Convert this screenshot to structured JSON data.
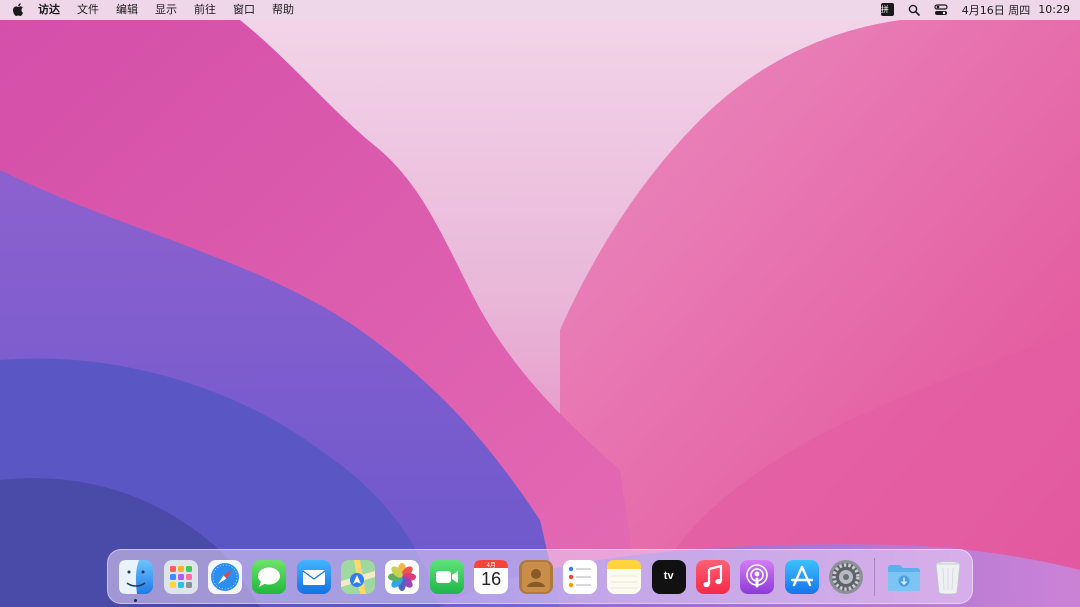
{
  "menubar": {
    "app_name": "访达",
    "menus": [
      "文件",
      "编辑",
      "显示",
      "前往",
      "窗口",
      "帮助"
    ],
    "input_method": "拼",
    "date": "4月16日 周四",
    "time": "10:29"
  },
  "dock": {
    "apps": [
      {
        "name": "finder-icon",
        "running": true
      },
      {
        "name": "launchpad-icon"
      },
      {
        "name": "safari-icon"
      },
      {
        "name": "messages-icon"
      },
      {
        "name": "mail-icon"
      },
      {
        "name": "maps-icon"
      },
      {
        "name": "photos-icon"
      },
      {
        "name": "facetime-icon"
      },
      {
        "name": "calendar-icon",
        "month_label": "4月",
        "day": "16"
      },
      {
        "name": "contacts-icon"
      },
      {
        "name": "reminders-icon"
      },
      {
        "name": "notes-icon"
      },
      {
        "name": "apple-tv-icon",
        "label": "tv"
      },
      {
        "name": "music-icon"
      },
      {
        "name": "podcasts-icon"
      },
      {
        "name": "app-store-icon"
      },
      {
        "name": "system-preferences-icon"
      }
    ],
    "others": [
      {
        "name": "downloads-folder-icon"
      },
      {
        "name": "trash-icon"
      }
    ]
  },
  "colors": {
    "menubar_bg": "#eed7ea",
    "wallpaper_top": "#e9c6e2",
    "wallpaper_pink": "#e6559e",
    "wallpaper_purple": "#7a5fd0",
    "wallpaper_deep": "#4a4aa8"
  }
}
